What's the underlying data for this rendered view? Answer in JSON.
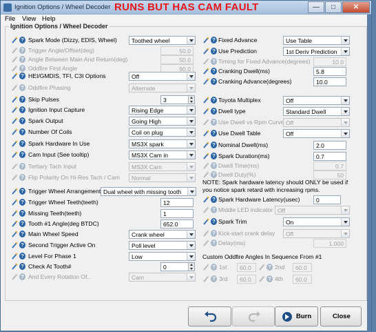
{
  "window": {
    "title": "Ignition Options / Wheel Decoder"
  },
  "caption": "RUNS BUT HAS CAM FAULT",
  "menu": {
    "file": "File",
    "view": "View",
    "help": "Help"
  },
  "group_title": "Ignition Options / Wheel Decoder",
  "left": {
    "spark_mode": {
      "label": "Spark Mode (Dizzy, EDIS, Wheel)",
      "value": "Toothed wheel"
    },
    "trigger_angle": {
      "label": "Trigger Angle/Offset(deg)",
      "value": "50.0"
    },
    "angle_between": {
      "label": "Angle Between Main And Return(deg)",
      "value": "50.0"
    },
    "oddfire_first": {
      "label": "Oddfire First Angle",
      "value": "90.0"
    },
    "hei": {
      "label": "HEI/GMDIS, TFI, C3I Options",
      "value": "Off"
    },
    "oddfire_phasing": {
      "label": "Oddfire Phasing",
      "value": "Alternate"
    },
    "skip_pulses": {
      "label": "Skip Pulses",
      "value": "3"
    },
    "ignition_capture": {
      "label": "Ignition Input Capture",
      "value": "Rising Edge"
    },
    "spark_output": {
      "label": "Spark Output",
      "value": "Going High"
    },
    "num_coils": {
      "label": "Number Of Coils",
      "value": "Coil on plug"
    },
    "spark_hw": {
      "label": "Spark Hardware In Use",
      "value": "MS3X spark"
    },
    "cam_input": {
      "label": "Cam Input (See tooltip)",
      "value": "MS3X Cam in"
    },
    "tertiary": {
      "label": "Tertiary Tach Input",
      "value": "MS3X Cam"
    },
    "flip_polarity": {
      "label": "Flip Polarity On Hi-Res Tach / Cam",
      "value": "Normal"
    },
    "trigger_arr": {
      "label": "Trigger Wheel Arrangement",
      "value": "Dual wheel with missing tooth"
    },
    "trigger_teeth": {
      "label": "Trigger Wheel Teeth(teeth)",
      "value": "12"
    },
    "missing_teeth": {
      "label": "Missing Teeth(teeth)",
      "value": "1"
    },
    "tooth1": {
      "label": "Tooth #1 Angle(deg BTDC)",
      "value": "652.0"
    },
    "main_speed": {
      "label": "Main Wheel Speed",
      "value": "Crank wheel"
    },
    "second_trigger": {
      "label": "Second Trigger Active On",
      "value": "Poll level"
    },
    "level_phase": {
      "label": "Level For Phase 1",
      "value": "Low"
    },
    "check_tooth": {
      "label": "Check At Tooth#",
      "value": "0"
    },
    "every_rotation": {
      "label": "And Every Rotation Of..",
      "value": "Cam"
    }
  },
  "right": {
    "fixed_advance": {
      "label": "Fixed Advance",
      "value": "Use Table"
    },
    "use_prediction": {
      "label": "Use Prediction",
      "value": "1st Deriv Prediction"
    },
    "timing_fixed": {
      "label": "Timing for Fixed Advance(degrees)",
      "value": "10.0"
    },
    "cranking_dwell": {
      "label": "Cranking Dwell(ms)",
      "value": "5.8"
    },
    "cranking_advance": {
      "label": "Cranking Advance(degrees)",
      "value": "10.0"
    },
    "toyota_mux": {
      "label": "Toyota Multiplex",
      "value": "Off"
    },
    "dwell_type": {
      "label": "Dwell type",
      "value": "Standard Dwell"
    },
    "dwell_vs_rpm": {
      "label": "Use Dwell vs Rpm Curve",
      "value": "Off"
    },
    "dwell_table": {
      "label": "Use Dwell Table",
      "value": "Off"
    },
    "nominal_dwell": {
      "label": "Nominal Dwell(ms)",
      "value": "2.0"
    },
    "spark_duration": {
      "label": "Spark Duration(ms)",
      "value": "0.7"
    },
    "dwell_time": {
      "label": "Dwell Time(ms)",
      "value": "0.7"
    },
    "dwell_duty": {
      "label": "Dwell Duty(%)",
      "value": "50"
    },
    "note1": "NOTE: Spark hardware latency should ONLY be used if",
    "note2": "you notice spark retard with increasing rpms.",
    "spark_latency": {
      "label": "Spark Hardware Latency(usec)",
      "value": "0"
    },
    "middle_led": {
      "label": "Middle LED indicator",
      "value": "Off"
    },
    "spark_trim": {
      "label": "Spark Trim",
      "value": "On"
    },
    "kick_start": {
      "label": "Kick-start crank delay",
      "value": "Off"
    },
    "delay": {
      "label": "Delay(ms)",
      "value": "1.000"
    },
    "custom_header": "Custom Oddfire Angles In Sequence From #1",
    "first": {
      "label": "1st",
      "value": "60.0"
    },
    "second": {
      "label": "2nd",
      "value": "60.0"
    },
    "third": {
      "label": "3rd",
      "value": "60.0"
    },
    "fourth": {
      "label": "4th",
      "value": "60.0"
    }
  },
  "buttons": {
    "burn": "Burn",
    "close": "Close"
  },
  "colors": {
    "caption": "#e8151b",
    "help_icon": "#2a64a8"
  }
}
